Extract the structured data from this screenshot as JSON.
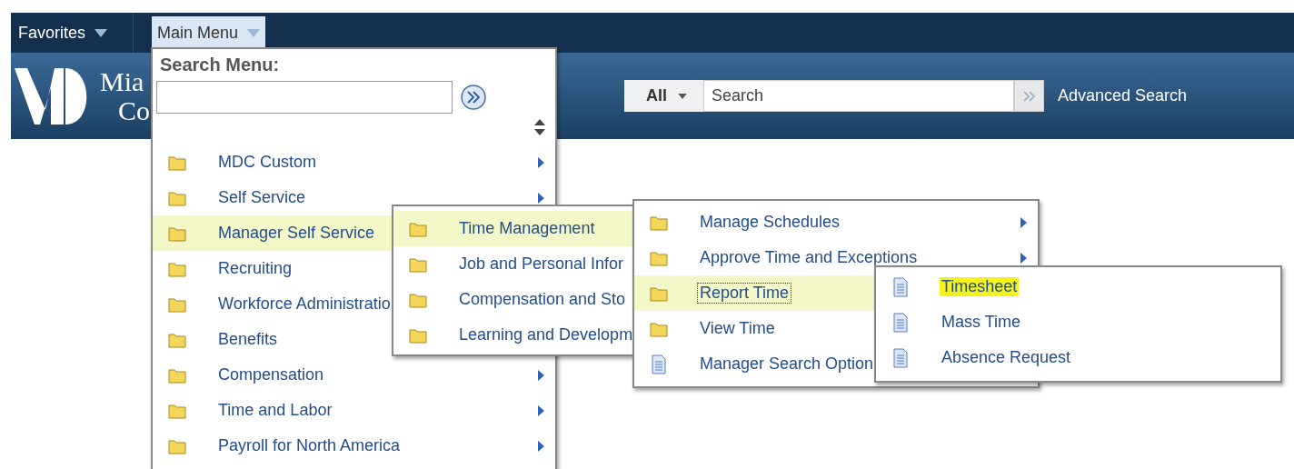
{
  "nav": {
    "favorites": "Favorites",
    "main_menu": "Main Menu",
    "main_menu_open": true
  },
  "logo": {
    "line_1": "Mia",
    "line_2": "Co"
  },
  "search": {
    "scope": "All",
    "placeholder": "Search",
    "advanced": "Advanced Search"
  },
  "main_menu": {
    "title": "Search Menu:",
    "items": [
      {
        "label": "MDC Custom",
        "kind": "folder",
        "submenu": true,
        "selected": false
      },
      {
        "label": "Self Service",
        "kind": "folder",
        "submenu": true,
        "selected": false
      },
      {
        "label": "Manager Self Service",
        "kind": "folder",
        "selected": true
      },
      {
        "label": "Recruiting",
        "kind": "folder",
        "selected": false
      },
      {
        "label": "Workforce Administratio",
        "kind": "folder",
        "selected": false
      },
      {
        "label": "Benefits",
        "kind": "folder",
        "selected": false
      },
      {
        "label": "Compensation",
        "kind": "folder",
        "submenu": true,
        "selected": false
      },
      {
        "label": "Time and Labor",
        "kind": "folder",
        "submenu": true,
        "selected": false
      },
      {
        "label": "Payroll for North America",
        "kind": "folder",
        "submenu": true,
        "selected": false
      }
    ]
  },
  "submenu_1": {
    "items": [
      {
        "label": "Time Management",
        "kind": "folder",
        "selected": true
      },
      {
        "label": "Job and Personal Infor",
        "kind": "folder",
        "selected": false
      },
      {
        "label": "Compensation and Sto",
        "kind": "folder",
        "selected": false
      },
      {
        "label": "Learning and Developm",
        "kind": "folder",
        "selected": false
      }
    ]
  },
  "submenu_2": {
    "items": [
      {
        "label": "Manage Schedules",
        "kind": "folder",
        "submenu": true,
        "selected": false,
        "focused": false
      },
      {
        "label": "Approve Time and Exceptions",
        "kind": "folder",
        "submenu": true,
        "selected": false,
        "focused": false
      },
      {
        "label": "Report Time",
        "kind": "folder",
        "submenu": false,
        "selected": true,
        "focused": true
      },
      {
        "label": "View Time",
        "kind": "folder",
        "selected": false,
        "focused": false
      },
      {
        "label": "Manager Search Option",
        "kind": "page",
        "selected": false,
        "focused": false
      }
    ]
  },
  "submenu_3": {
    "items": [
      {
        "label": "Timesheet",
        "kind": "page",
        "selected": false,
        "marked": true
      },
      {
        "label": "Mass Time",
        "kind": "page",
        "selected": false,
        "marked": false
      },
      {
        "label": "Absence Request",
        "kind": "page",
        "selected": false,
        "marked": false
      }
    ]
  }
}
